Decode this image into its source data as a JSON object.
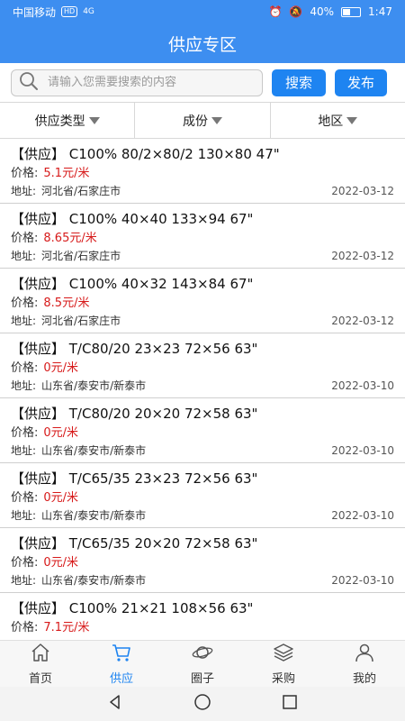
{
  "status_bar": {
    "carrier": "中国移动",
    "hd": "HD",
    "network": "4G",
    "battery": "40%",
    "time": "1:47"
  },
  "header": {
    "title": "供应专区"
  },
  "search": {
    "placeholder": "请输入您需要搜索的内容",
    "value": "",
    "search_label": "搜索",
    "publish_label": "发布"
  },
  "filters": [
    {
      "label": "供应类型"
    },
    {
      "label": "成份"
    },
    {
      "label": "地区"
    }
  ],
  "price_label": "价格:",
  "address_label": "地址:",
  "items": [
    {
      "title": "【供应】 C100% 80/2×80/2 130×80 47\"",
      "price": "5.1元/米",
      "address": "河北省/石家庄市",
      "date": "2022-03-12"
    },
    {
      "title": "【供应】 C100% 40×40 133×94 67\"",
      "price": "8.65元/米",
      "address": "河北省/石家庄市",
      "date": "2022-03-12"
    },
    {
      "title": "【供应】 C100% 40×32 143×84 67\"",
      "price": "8.5元/米",
      "address": "河北省/石家庄市",
      "date": "2022-03-12"
    },
    {
      "title": "【供应】 T/C80/20 23×23 72×56 63\"",
      "price": "0元/米",
      "address": "山东省/泰安市/新泰市",
      "date": "2022-03-10"
    },
    {
      "title": "【供应】 T/C80/20 20×20 72×58 63\"",
      "price": "0元/米",
      "address": "山东省/泰安市/新泰市",
      "date": "2022-03-10"
    },
    {
      "title": "【供应】 T/C65/35 23×23 72×56 63\"",
      "price": "0元/米",
      "address": "山东省/泰安市/新泰市",
      "date": "2022-03-10"
    },
    {
      "title": "【供应】 T/C65/35 20×20 72×58 63\"",
      "price": "0元/米",
      "address": "山东省/泰安市/新泰市",
      "date": "2022-03-10"
    },
    {
      "title": "【供应】 C100% 21×21 108×56 63\"",
      "price": "7.1元/米",
      "address": "",
      "date": ""
    }
  ],
  "tabbar": [
    {
      "label": "首页",
      "icon": "home-icon"
    },
    {
      "label": "供应",
      "icon": "cart-icon",
      "active": true
    },
    {
      "label": "圈子",
      "icon": "planet-icon"
    },
    {
      "label": "采购",
      "icon": "stack-icon"
    },
    {
      "label": "我的",
      "icon": "person-icon"
    }
  ],
  "colors": {
    "header_blue": "#3d8ef0",
    "button_blue": "#1e84f1",
    "price_red": "#d71a1a"
  }
}
